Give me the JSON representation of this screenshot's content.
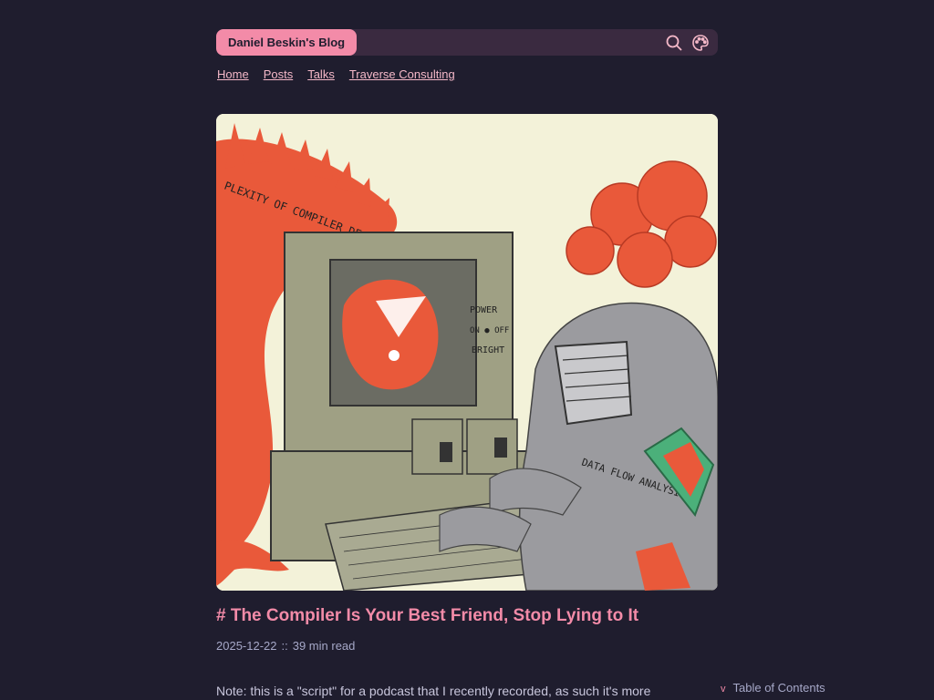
{
  "header": {
    "blog_title": "Daniel Beskin's Blog",
    "search_icon": "search-icon",
    "theme_icon": "palette-icon"
  },
  "nav": {
    "items": [
      "Home",
      "Posts",
      "Talks",
      "Traverse Consulting"
    ]
  },
  "hero_image": {
    "texts": {
      "dragon_banner": "PLEXITY OF COMPILER DESIGN",
      "power": "POWER",
      "on_off": "ON ● OFF",
      "bright": "BRIGHT",
      "armor": "DATA FLOW ANALYSIS"
    }
  },
  "post": {
    "title": "# The Compiler Is Your Best Friend, Stop Lying to It",
    "date": "2025-12-22",
    "separator": "::",
    "read_time": "39 min read",
    "note": "Note: this is a \"script\" for a podcast that I recently recorded, as such it's more"
  },
  "toc": {
    "chevron": "v",
    "label": "Table of Contents"
  },
  "colors": {
    "background": "#1f1d2e",
    "accent": "#f38ba8",
    "link": "#f4b8c8",
    "text": "#c8c6dc"
  }
}
